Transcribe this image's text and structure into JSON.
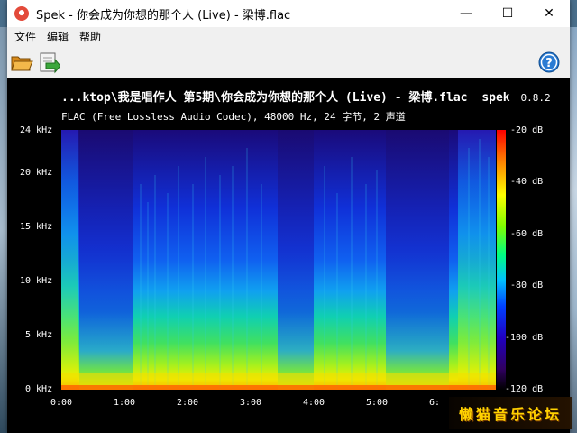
{
  "window": {
    "title": "Spek - 你会成为你想的那个人 (Live) - 梁博.flac",
    "minimize_glyph": "—",
    "maximize_glyph": "☐",
    "close_glyph": "✕"
  },
  "menu": {
    "items": [
      "文件",
      "编辑",
      "帮助"
    ]
  },
  "toolbar": {
    "open_icon": "open-folder-icon",
    "save_icon": "save-export-icon",
    "help_icon": "help-icon"
  },
  "spectrogram": {
    "file_title": "...ktop\\我是唱作人 第5期\\你会成为你想的那个人 (Live) - 梁博.flac",
    "app_label": "spek",
    "version": "0.8.2",
    "info": "FLAC (Free Lossless Audio Codec), 48000 Hz, 24 字节, 2 声道",
    "freq_ticks": [
      "24 kHz",
      "20 kHz",
      "15 kHz",
      "10 kHz",
      "5 kHz",
      "0 kHz"
    ],
    "time_ticks": [
      "0:00",
      "1:00",
      "2:00",
      "3:00",
      "4:00",
      "5:00",
      "6:"
    ],
    "db_ticks": [
      "-20 dB",
      "-40 dB",
      "-60 dB",
      "-80 dB",
      "-100 dB",
      "-120 dB"
    ]
  },
  "watermark": {
    "text": "懒猫音乐论坛"
  }
}
